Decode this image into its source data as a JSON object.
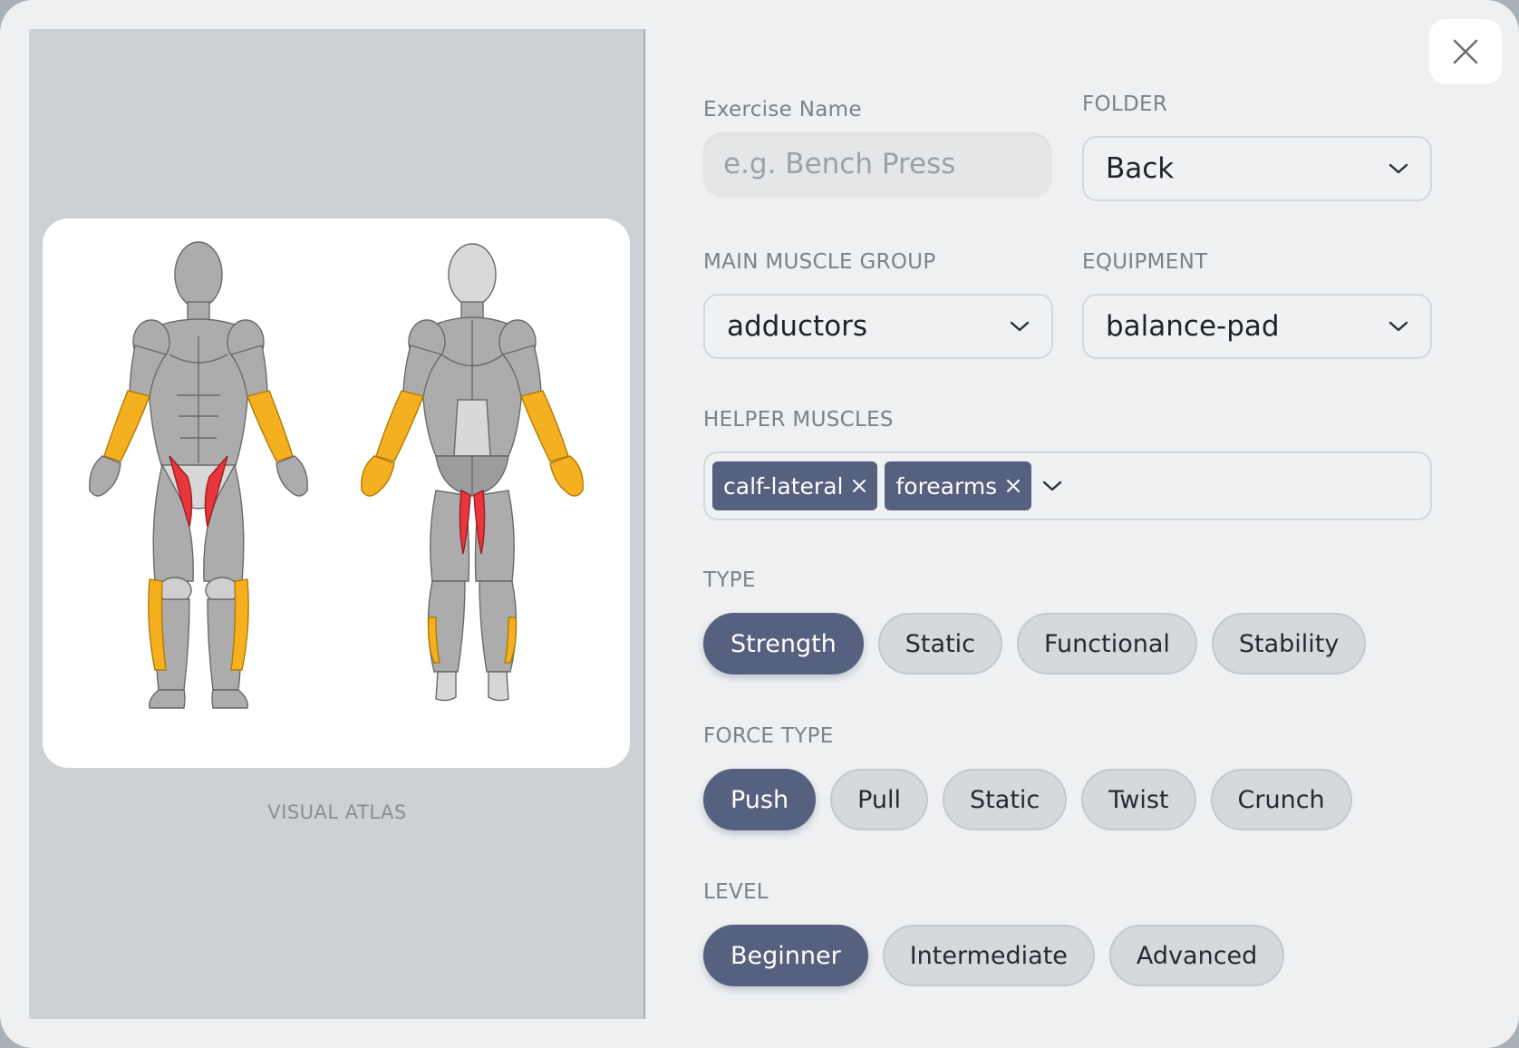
{
  "atlas": {
    "label": "VISUAL ATLAS",
    "colors": {
      "primary": "#e8373c",
      "secondary": "#f4b01e",
      "base": "#a9a9a9"
    }
  },
  "form": {
    "exercise_name": {
      "label": "Exercise Name",
      "placeholder": "e.g. Bench Press",
      "value": ""
    },
    "folder": {
      "label": "FOLDER",
      "value": "Back"
    },
    "main_muscle": {
      "label": "MAIN MUSCLE GROUP",
      "value": "adductors"
    },
    "equipment": {
      "label": "EQUIPMENT",
      "value": "balance-pad"
    },
    "helper_muscles": {
      "label": "HELPER MUSCLES",
      "chips": [
        "calf-lateral",
        "forearms"
      ]
    },
    "type": {
      "label": "TYPE",
      "options": [
        "Strength",
        "Static",
        "Functional",
        "Stability"
      ],
      "selected": "Strength"
    },
    "force_type": {
      "label": "FORCE TYPE",
      "options": [
        "Push",
        "Pull",
        "Static",
        "Twist",
        "Crunch"
      ],
      "selected": "Push"
    },
    "level": {
      "label": "LEVEL",
      "options": [
        "Beginner",
        "Intermediate",
        "Advanced"
      ],
      "selected": "Beginner"
    }
  },
  "icons": {
    "close": "close-icon",
    "dropdown": "chevron-down-icon",
    "remove_chip": "close-icon"
  },
  "theme": {
    "accent": "#56607f",
    "pill_inactive": "#d5d8dc",
    "background": "#eef0f2"
  }
}
